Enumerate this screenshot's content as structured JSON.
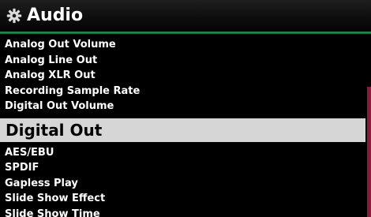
{
  "header": {
    "icon": "gear-icon",
    "title": "Audio",
    "accent_color": "#2e8b57"
  },
  "menu": {
    "items": [
      {
        "label": "Analog Out Volume",
        "selected": false
      },
      {
        "label": "Analog Line Out",
        "selected": false
      },
      {
        "label": "Analog XLR Out",
        "selected": false
      },
      {
        "label": "Recording Sample Rate",
        "selected": false
      },
      {
        "label": "Digital Out Volume",
        "selected": false
      },
      {
        "label": "Digital Out",
        "selected": true
      },
      {
        "label": "AES/EBU",
        "selected": false
      },
      {
        "label": "SPDIF",
        "selected": false
      },
      {
        "label": "Gapless Play",
        "selected": false
      },
      {
        "label": "Slide Show Effect",
        "selected": false
      },
      {
        "label": "Slide Show Time",
        "selected": false
      }
    ],
    "selected_background": "#d6d6d6"
  },
  "scrollbar": {
    "thumb_color": "#8a1a3a"
  }
}
